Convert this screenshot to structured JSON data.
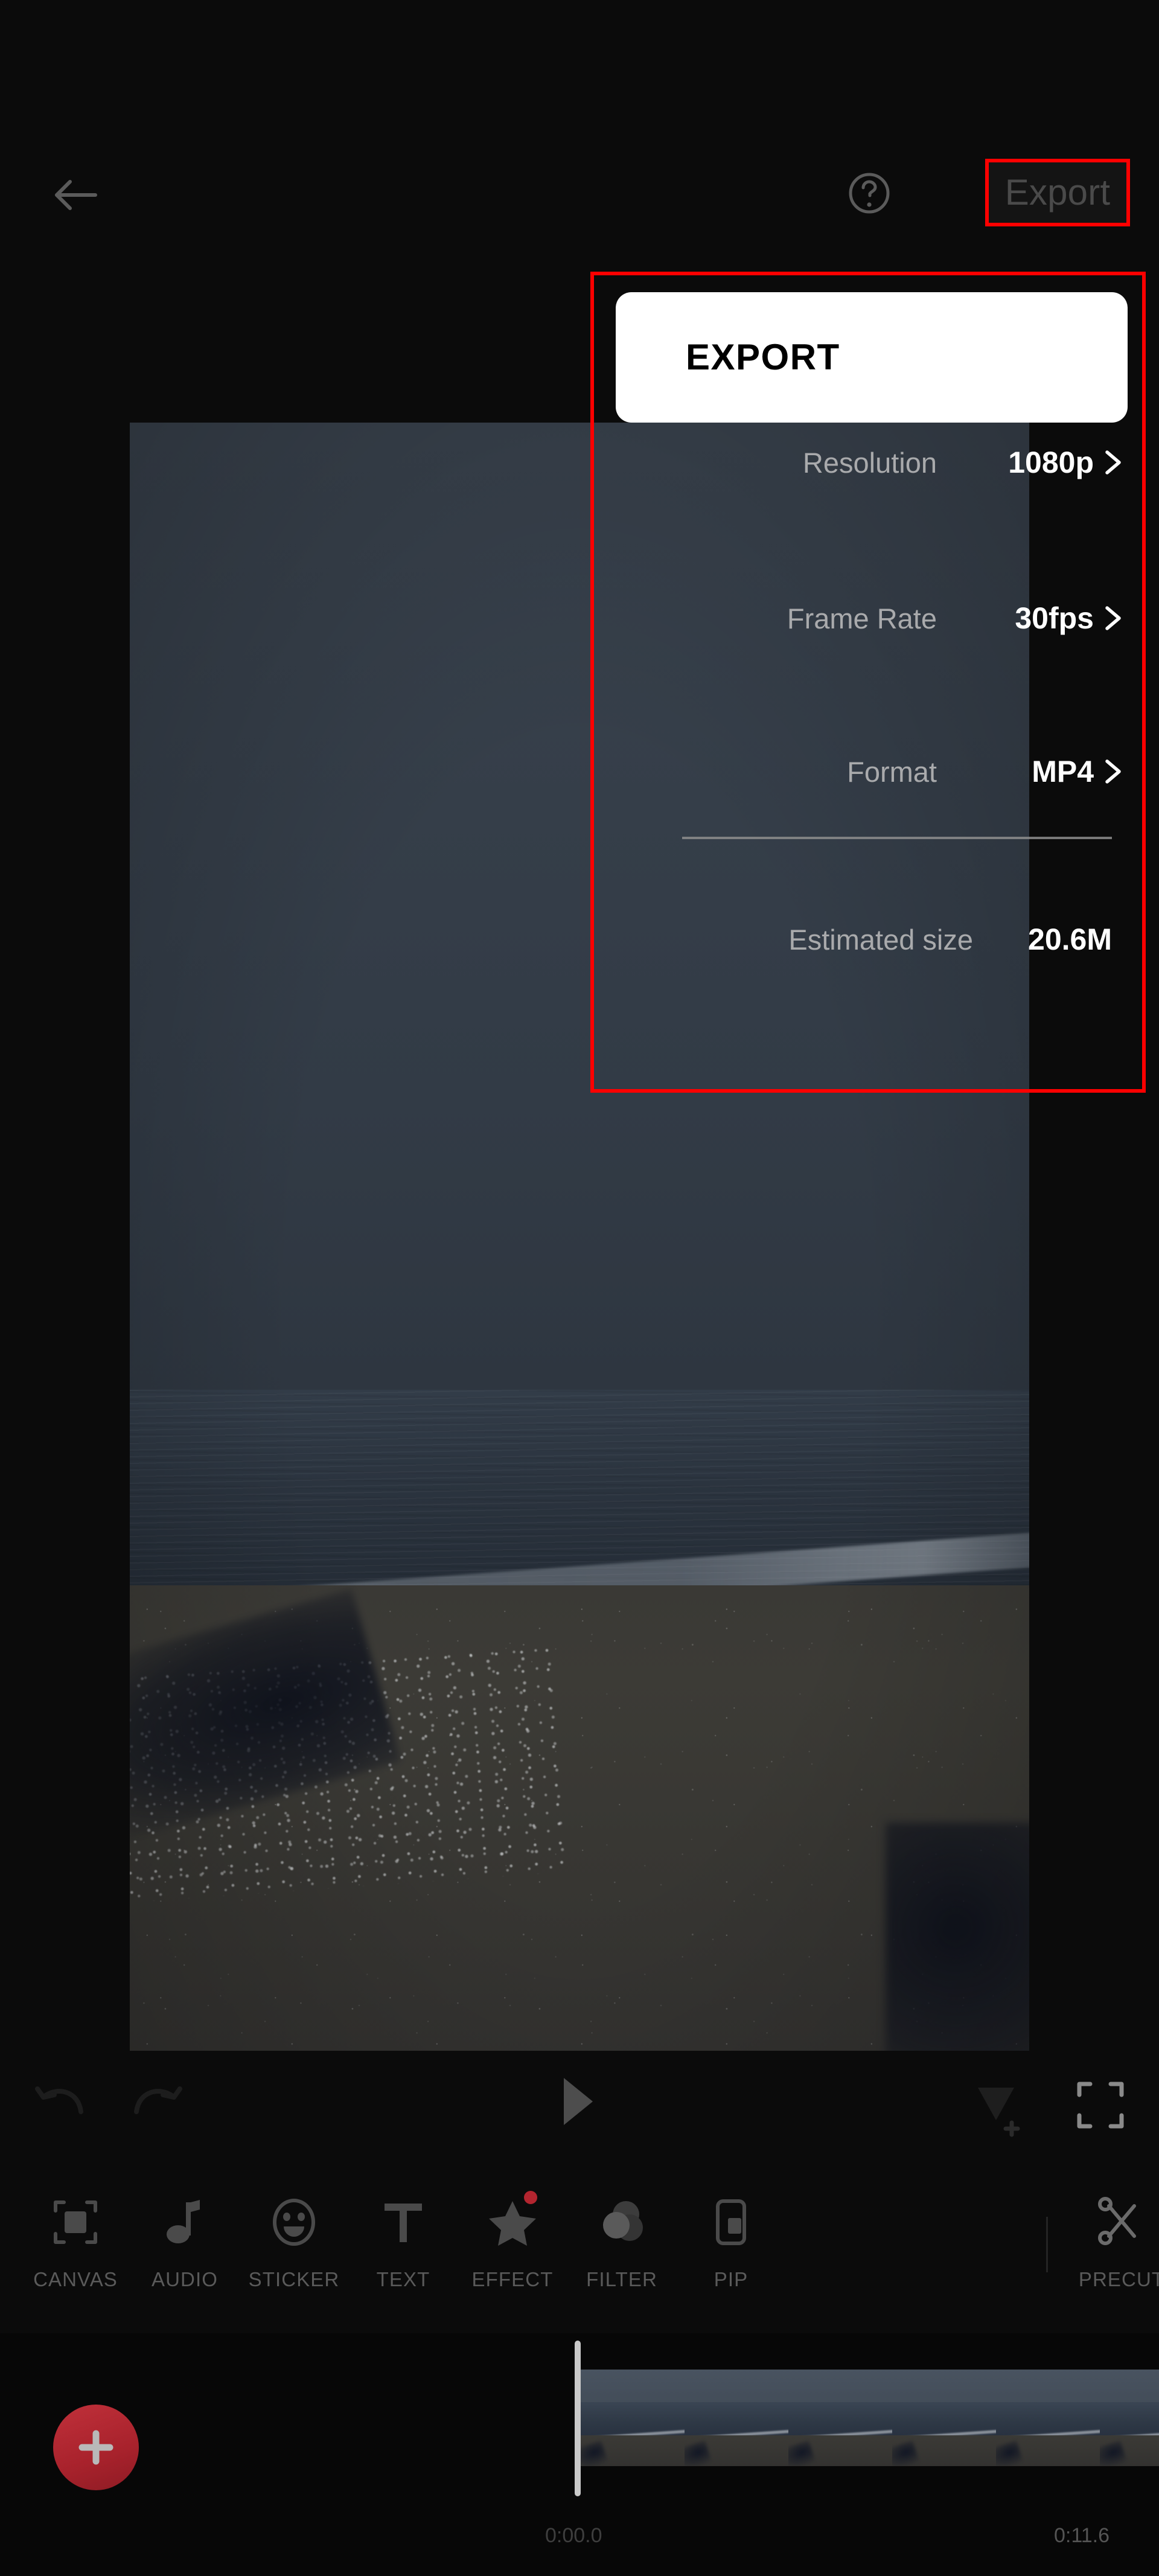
{
  "topbar": {
    "back_icon": "back-arrow-icon",
    "help_icon": "help-circle-icon",
    "export_label": "Export"
  },
  "export_panel": {
    "title": "EXPORT",
    "rows": [
      {
        "label": "Resolution",
        "value": "1080p",
        "chevron": "chevron-right-icon"
      },
      {
        "label": "Frame Rate",
        "value": "30fps",
        "chevron": "chevron-right-icon"
      },
      {
        "label": "Format",
        "value": "MP4",
        "chevron": "chevron-right-icon"
      },
      {
        "label": "Estimated size",
        "value": "20.6M",
        "chevron": ""
      }
    ],
    "highlight_color": "#ff0000"
  },
  "playback": {
    "undo_icon": "undo-arrow-icon",
    "redo_icon": "redo-arrow-icon",
    "play_icon": "play-triangle-icon",
    "keyframe_icon": "add-keyframe-icon",
    "fullscreen_icon": "fullscreen-icon"
  },
  "toolbar": {
    "items": [
      {
        "label": "CANVAS",
        "icon": "canvas-frame-icon",
        "badge": false
      },
      {
        "label": "AUDIO",
        "icon": "music-note-icon",
        "badge": false
      },
      {
        "label": "STICKER",
        "icon": "smiley-face-icon",
        "badge": false
      },
      {
        "label": "TEXT",
        "icon": "text-t-icon",
        "badge": false
      },
      {
        "label": "EFFECT",
        "icon": "star-icon",
        "badge": true
      },
      {
        "label": "FILTER",
        "icon": "filter-circles-icon",
        "badge": false
      },
      {
        "label": "PIP",
        "icon": "picture-in-picture-icon",
        "badge": false
      },
      {
        "label": "PRECUT",
        "icon": "scissors-icon",
        "badge": false
      }
    ]
  },
  "timeline": {
    "add_clip_icon": "plus-icon",
    "playhead_position": "0:00.0",
    "time_start": "0:00.0",
    "time_end": "0:11.6",
    "accent_color": "#b3252f"
  }
}
